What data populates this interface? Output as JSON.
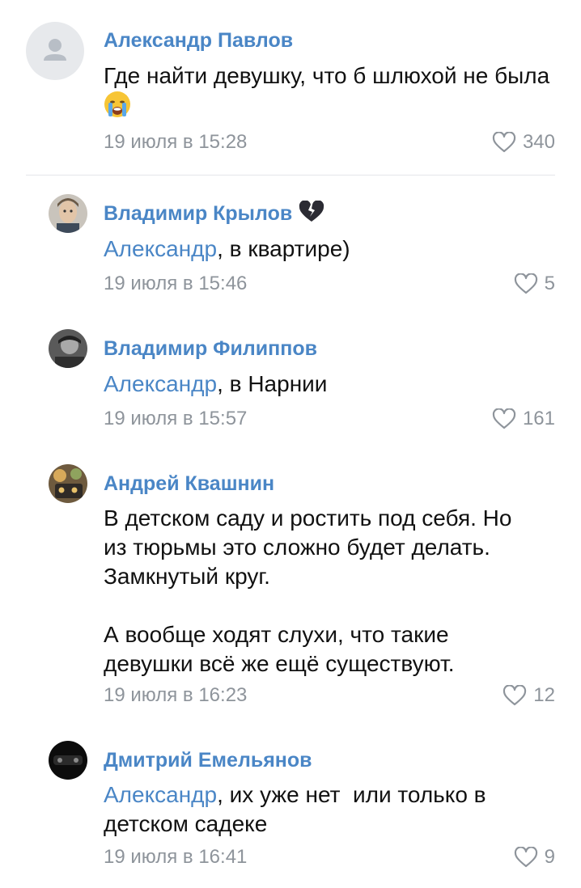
{
  "comments": [
    {
      "author": "Александр Павлов",
      "text": "Где найти девушку, что б шлюхой не была",
      "emoji": "crying-face",
      "time": "19 июля в 15:28",
      "likes": "340"
    },
    {
      "author": "Владимир Крылов",
      "author_badge": "🖤",
      "mention": "Александр",
      "text": ", в квартире)",
      "time": "19 июля в 15:46",
      "likes": "5"
    },
    {
      "author": "Владимир Филиппов",
      "mention": "Александр",
      "text": ", в Нарнии",
      "time": "19 июля в 15:57",
      "likes": "161"
    },
    {
      "author": "Андрей Квашнин",
      "text_lines": [
        "В детском саду и ростить под себя. Но",
        "из тюрьмы это сложно будет делать.",
        "Замкнутый круг.",
        "",
        "А вообще ходят слухи, что такие",
        "девушки всё же ещё существуют."
      ],
      "time": "19 июля в 16:23",
      "likes": "12"
    },
    {
      "author": "Дмитрий Емельянов",
      "mention": "Александр",
      "text": ", их уже нет  или только в",
      "text2": "детском садеке",
      "time": "19 июля в 16:41",
      "likes": "9"
    }
  ],
  "colors": {
    "link": "#4a86c6",
    "meta": "#8e949b",
    "divider": "#e4e6ea"
  }
}
